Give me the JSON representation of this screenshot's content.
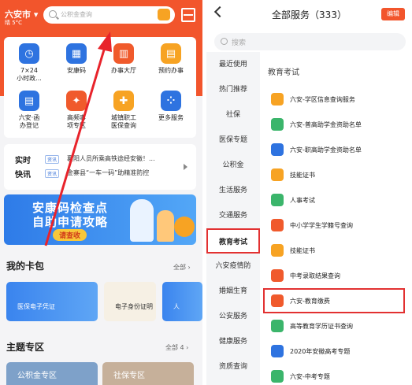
{
  "left": {
    "header": {
      "city": "六安市",
      "weather": "晴 5°C",
      "search_placeholder": "公积金查询"
    },
    "grid": [
      {
        "label": "7×24\n小时政...",
        "color": "#2e73e0",
        "icon": "clock-icon"
      },
      {
        "label": "安康码",
        "color": "#2e73e0",
        "icon": "qr-icon"
      },
      {
        "label": "办事大厅",
        "color": "#f05a2c",
        "icon": "building-icon"
      },
      {
        "label": "预约办事",
        "color": "#f7a323",
        "icon": "calendar-icon"
      },
      {
        "label": "六安·函\n办登记",
        "color": "#2e73e0",
        "icon": "doc-icon"
      },
      {
        "label": "高频事\n项专区",
        "color": "#f05a2c",
        "icon": "hot-icon"
      },
      {
        "label": "城镇职工\n医保查询",
        "color": "#f7a323",
        "icon": "medical-icon"
      },
      {
        "label": "更多服务",
        "color": "#2e73e0",
        "icon": "more-icon"
      }
    ],
    "news": {
      "label_top": "实时",
      "label_bottom": "快讯",
      "items": [
        {
          "tag": "资讯",
          "text": "襄阳人员所乘高铁途经安徽！..."
        },
        {
          "tag": "资讯",
          "text": "金寨县“一车一码”助精准防控"
        }
      ]
    },
    "banner": {
      "line1": "安康码检查点",
      "line2": "自助申请攻略",
      "cta": "请查收"
    },
    "cards": {
      "title": "我的卡包",
      "all_label": "全部",
      "items": [
        {
          "text": "医保电子凭证"
        },
        {
          "text": "电子身份证明"
        },
        {
          "text": "人"
        }
      ]
    },
    "topics": {
      "title": "主题专区",
      "all_label": "全部 4",
      "items": [
        {
          "text": "公积金专区"
        },
        {
          "text": "社保专区"
        }
      ]
    }
  },
  "right": {
    "title": "全部服务（333）",
    "edit_label": "编辑",
    "search_placeholder": "搜索",
    "sidebar": [
      "最近使用",
      "热门推荐",
      "社保",
      "医保专题",
      "公积金",
      "生活服务",
      "交通服务",
      "教育考试",
      "六安疫情防",
      "婚姻生育",
      "公安服务",
      "健康服务",
      "资质查询"
    ],
    "active_index": 7,
    "category_title": "教育考试",
    "services": [
      {
        "label": "六安-学区信息查询服务",
        "color": "#f7a323"
      },
      {
        "label": "六安-普高助学金资助名单",
        "color": "#3bb56b"
      },
      {
        "label": "六安-职高助学金资助名单",
        "color": "#2e73e0"
      },
      {
        "label": "技能证书",
        "color": "#f7a323"
      },
      {
        "label": "人事考试",
        "color": "#3bb56b"
      },
      {
        "label": "中小学学生学籍号查询",
        "color": "#f05a2c"
      },
      {
        "label": "技能证书",
        "color": "#f7a323"
      },
      {
        "label": "中考录取结果查询",
        "color": "#f05a2c"
      },
      {
        "label": "六安-教育缴费",
        "color": "#f05a2c"
      },
      {
        "label": "高等教育学历证书查询",
        "color": "#3bb56b"
      },
      {
        "label": "2020年安徽高考专题",
        "color": "#2e73e0"
      },
      {
        "label": "六安-中考专题",
        "color": "#3bb56b"
      }
    ],
    "highlighted_index": 8
  }
}
